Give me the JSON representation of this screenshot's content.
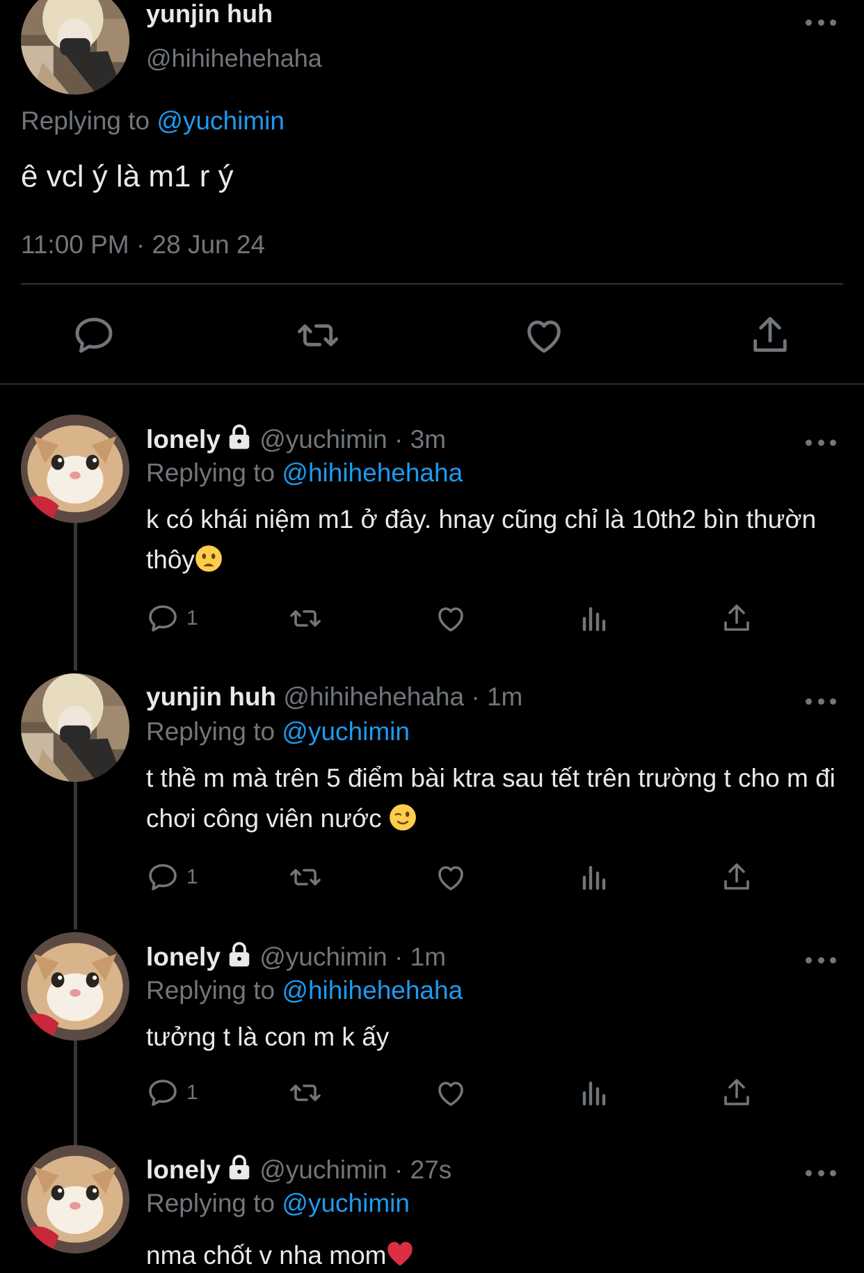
{
  "main": {
    "name": "yunjin huh",
    "handle": "@hihihehehaha",
    "replying_prefix": "Replying to ",
    "replying_to": "@yuchimin",
    "text": "ê vcl ý là m1 r ý",
    "timestamp": "11:00 PM · 28 Jun 24",
    "actions": [
      "reply-icon",
      "retweet-icon",
      "like-icon",
      "share-icon"
    ]
  },
  "replies": [
    {
      "name": "lonely",
      "protected": true,
      "handle": "@yuchimin",
      "time": " · 3m",
      "replying_prefix": "Replying to ",
      "replying_to": "@hihihehehaha",
      "text": "k có khái niệm m1 ở đây. hnay cũng chỉ là 10th2 bìn thườn thôy",
      "emoji": "frowning-face",
      "reply_count": "1"
    },
    {
      "name": "yunjin huh",
      "protected": false,
      "handle": "@hihihehehaha",
      "time": " · 1m",
      "replying_prefix": "Replying to ",
      "replying_to": "@yuchimin",
      "text": "t thề m mà trên 5 điểm bài ktra sau tết trên trường t cho m đi chơi công viên nước ",
      "emoji": "winking-face",
      "reply_count": "1"
    },
    {
      "name": "lonely",
      "protected": true,
      "handle": "@yuchimin",
      "time": " · 1m",
      "replying_prefix": "Replying to ",
      "replying_to": "@hihihehehaha",
      "text": "tưởng t là con m k ấy",
      "emoji": "",
      "reply_count": "1"
    },
    {
      "name": "lonely",
      "protected": true,
      "handle": "@yuchimin",
      "time": " · 27s",
      "replying_prefix": "Replying to ",
      "replying_to": "@yuchimin",
      "text": "nma chốt v nha mom",
      "emoji": "red-heart",
      "reply_count": ""
    }
  ],
  "colors": {
    "background": "#000000",
    "text": "#e7e9ea",
    "muted": "#71767b",
    "link": "#1d9bf0",
    "divider": "#2f3336"
  }
}
